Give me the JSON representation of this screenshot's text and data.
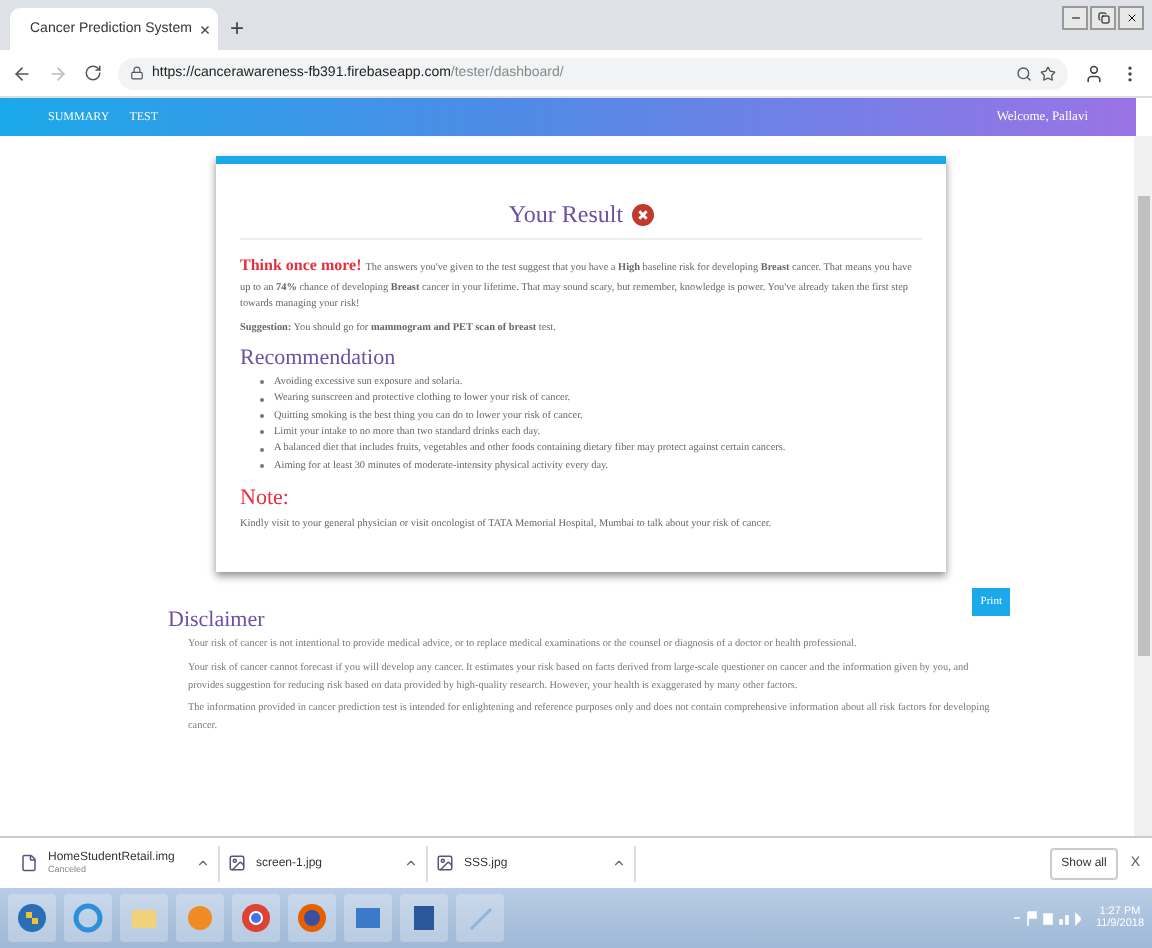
{
  "browser": {
    "tab": {
      "title": "Cancer Prediction System",
      "close": "×"
    },
    "new_tab": "+",
    "url": {
      "host": "https://cancerawareness-fb391.firebaseapp.com",
      "path": "/tester/dashboard/"
    }
  },
  "nav": {
    "links": [
      {
        "label": "SUMMARY"
      },
      {
        "label": "TEST"
      }
    ],
    "welcome": "Welcome, Pallavi"
  },
  "result": {
    "title": "Your Result",
    "alert": "Think once more!",
    "message": "The answers you've given to the test suggest that you have a **High** baseline risk for developing **Breast** cancer. That means you have up to an **74%** chance of developing **Breast** cancer in your lifetime. That may sound scary, but remember, knowledge is power. You've already taken the first step towards managing your risk!",
    "suggestion": "**Suggestion:** You should go for **mammogram and PET scan of breast** test.",
    "recommendation_title": "Recommendation",
    "recommendations": [
      "Avoiding excessive sun exposure and solaria.",
      "Wearing sunscreen and protective clothing to lower your risk of cancer.",
      "Quitting smoking is the best thing you can do to lower your risk of cancer.",
      "Limit your intake to no more than two standard drinks each day.",
      "A balanced diet that includes fruits, vegetables and other foods containing dietary fiber may protect against certain cancers.",
      "Aiming for at least 30 minutes of moderate-intensity physical activity every day."
    ],
    "note_title": "Note:",
    "note": "Kindly visit to your general physician or visit oncologist of TATA Memorial Hospital, Mumbai to talk about your risk of cancer."
  },
  "print_button": "Print",
  "disclaimer": {
    "title": "Disclaimer",
    "paragraphs": [
      "Your risk of cancer is not intentional to provide medical advice, or to replace medical examinations or the counsel or diagnosis of a doctor or health professional.",
      "Your risk of cancer cannot forecast if you will develop any cancer. It estimates your risk based on facts derived from large-scale questioner on cancer and the information given by you, and provides suggestion for reducing risk based on data provided by high-quality research. However, your health is exaggerated by many other factors.",
      "The information provided in cancer prediction test is intended for enlightening and reference purposes only and does not contain comprehensive information about all risk factors for developing cancer."
    ]
  },
  "downloads": {
    "items": [
      {
        "name": "HomeStudentRetail.img",
        "status": "Canceled",
        "kind": "file"
      },
      {
        "name": "screen-1.jpg",
        "kind": "image"
      },
      {
        "name": "SSS.jpg",
        "kind": "image"
      }
    ],
    "show_all": "Show all",
    "close": "X"
  },
  "taskbar": {
    "time": "1:27 PM",
    "date": "11/9/2018"
  }
}
